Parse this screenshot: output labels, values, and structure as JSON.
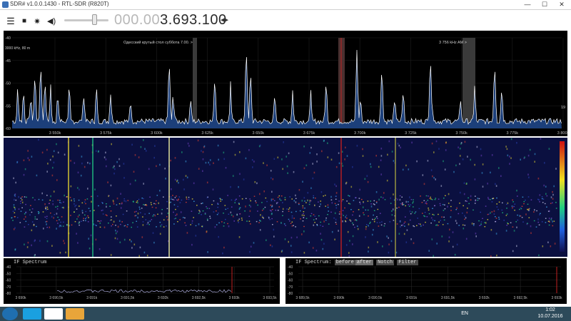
{
  "window": {
    "title": "SDR# v1.0.0.1430 - RTL-SDR (R820T)",
    "minimize": "—",
    "maximize": "☐",
    "close": "✕"
  },
  "toolbar": {
    "menu_icon": "menu-icon",
    "stop_icon": "stop-icon",
    "settings_icon": "gear-icon",
    "audio_icon": "speaker-icon",
    "frequency_dim": "000.00",
    "frequency_bright": "3.693.100",
    "tune_arrows": "◂▸"
  },
  "spectrum": {
    "labels": [
      "Одесский крутый стол суббота 7.00. >",
      "3 756 kHz AM >"
    ],
    "corner_label": "3000 kHz, 80 m",
    "y_ticks": [
      "-40",
      "-45",
      "-50",
      "-55",
      "-60"
    ],
    "x_ticks": [
      "3 550k",
      "3 575k",
      "3 600k",
      "3 625k",
      "3 650k",
      "3 675k",
      "3 700k",
      "3 725k",
      "3 750k",
      "3 775k",
      "3 800k"
    ],
    "right_value": "19"
  },
  "if1": {
    "title": "IF Spectrum",
    "y_ticks": [
      "-40",
      "-50",
      "-60",
      "-70",
      "-80"
    ],
    "x_ticks": [
      "3 690k",
      "3 690,5k",
      "3 691k",
      "3 691,5k",
      "3 692k",
      "3 692,5k",
      "3 693k",
      "3 693,5k"
    ]
  },
  "if2": {
    "title": "IF Spectrum:",
    "tabs": [
      "before",
      "after",
      "Notch",
      "Filter"
    ],
    "y_ticks": [
      "-40",
      "-50",
      "-60",
      "-70",
      "-80"
    ],
    "x_ticks": [
      "3 689,5k",
      "3 690k",
      "3 690,5k",
      "3 691k",
      "3 691,5k",
      "3 692k",
      "3 692,5k",
      "3 693k"
    ]
  },
  "taskbar": {
    "apps": [
      "skype-icon",
      "chrome-icon",
      "explorer-icon"
    ],
    "language": "EN",
    "time": "1:02",
    "date": "10.07.2016"
  },
  "colors": {
    "spectrum_bg": "#000000",
    "peak_fill": "#3c78c8",
    "waterfall_bg": "#0a0f3a",
    "marker": "#c02020"
  }
}
